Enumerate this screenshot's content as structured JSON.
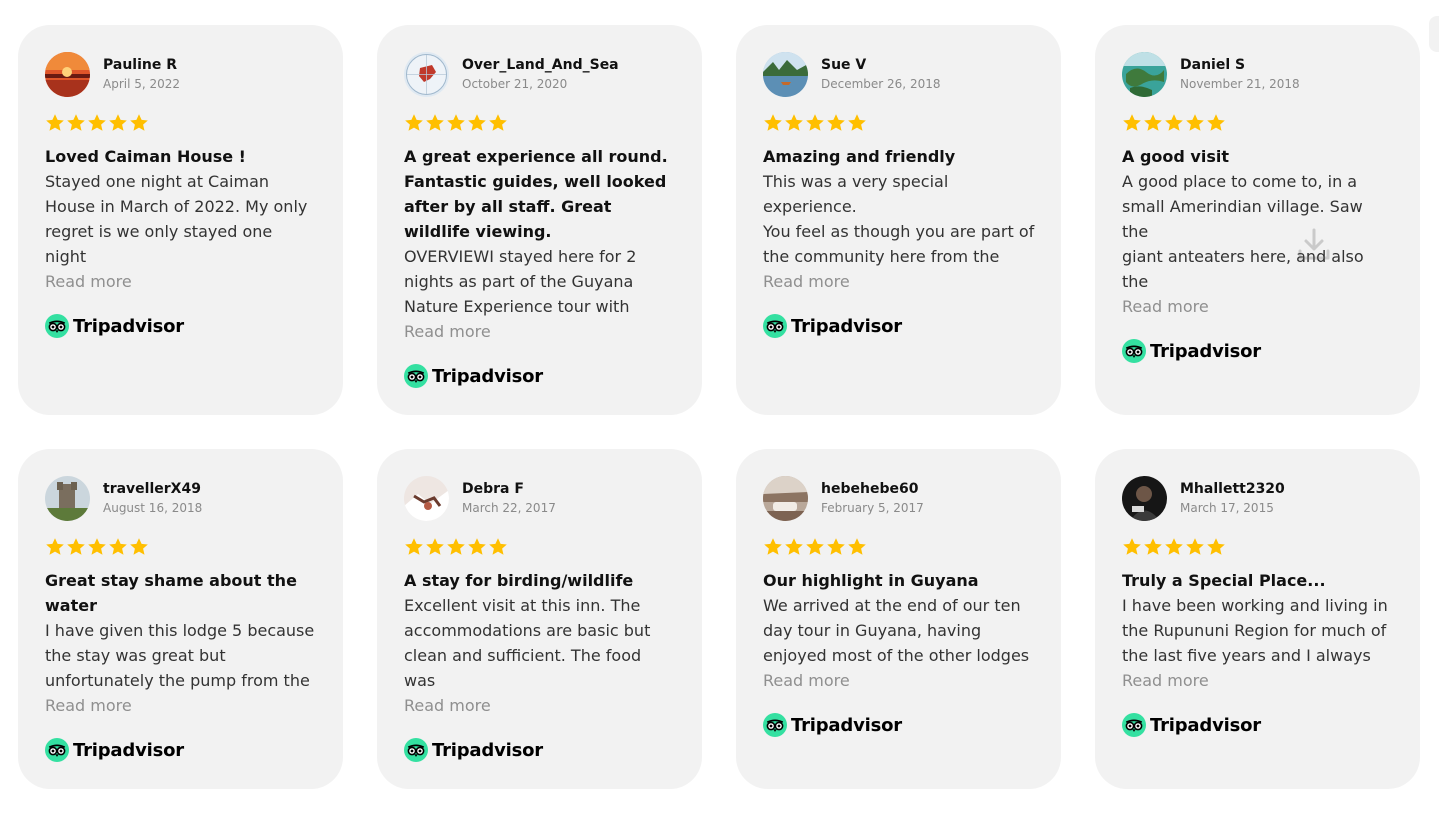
{
  "brand_label": "Tripadvisor",
  "read_more_label": "Read more",
  "colors": {
    "card_bg": "#f2f2f2",
    "star": "#ffbf00",
    "brand_green": "#34e0a1"
  },
  "reviews": [
    {
      "name": "Pauline R",
      "date": "April 5, 2022",
      "rating": 5,
      "avatar": "sunset-avatar",
      "title": "Loved Caiman House !",
      "lines": [
        "Stayed one night at Caiman",
        "House in March of 2022. My only",
        "regret is we only stayed one night"
      ]
    },
    {
      "name": "Over_Land_And_Sea",
      "date": "October 21, 2020",
      "rating": 5,
      "avatar": "globe-avatar",
      "title": "A great experience all round. Fantastic guides, well looked after by all staff. Great wildlife viewing.",
      "lines": [
        "OVERVIEWI stayed here for 2",
        "nights as part of the Guyana",
        "Nature Experience tour with"
      ]
    },
    {
      "name": "Sue V",
      "date": "December 26, 2018",
      "rating": 5,
      "avatar": "canoe-avatar",
      "title": "Amazing and friendly",
      "lines": [
        "This was a very special experience.",
        "You feel as though you are part of",
        "the community here from the"
      ]
    },
    {
      "name": "Daniel S",
      "date": "November 21, 2018",
      "rating": 5,
      "avatar": "islands-avatar",
      "title": "A good visit",
      "lines": [
        "A good place to come to, in a",
        "small Amerindian village. Saw the",
        "giant anteaters here, and also the"
      ]
    },
    {
      "name": "travellerX49",
      "date": "August 16, 2018",
      "rating": 5,
      "avatar": "castle-avatar",
      "title": "Great stay shame about the water",
      "lines": [
        "I have given this lodge 5 because",
        "the stay was great but",
        "unfortunately the pump from the"
      ]
    },
    {
      "name": "Debra F",
      "date": "March 22, 2017",
      "rating": 5,
      "avatar": "snow-avatar",
      "title": "A stay for birding/wildlife",
      "lines": [
        "Excellent visit at this inn. The",
        "accommodations are basic but",
        "clean and sufficient. The food was"
      ]
    },
    {
      "name": "hebehebe60",
      "date": "February 5, 2017",
      "rating": 5,
      "avatar": "car-avatar",
      "title": "Our highlight in Guyana",
      "lines": [
        "We arrived at the end of our ten",
        "day tour in Guyana, having",
        "enjoyed most of the other lodges"
      ]
    },
    {
      "name": "Mhallett2320",
      "date": "March 17, 2015",
      "rating": 5,
      "avatar": "person-avatar",
      "title": "Truly a Special Place...",
      "lines": [
        "I have been working and living in",
        "the Rupununi Region for much of",
        "the last five years and I always"
      ]
    }
  ]
}
